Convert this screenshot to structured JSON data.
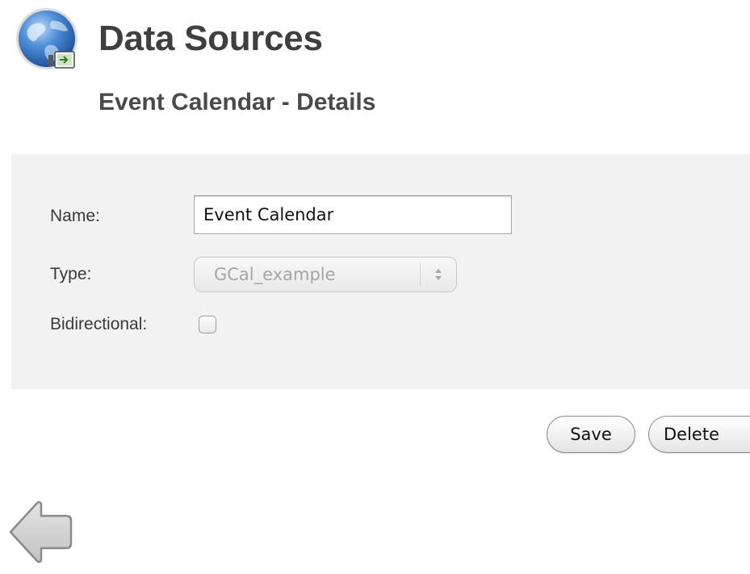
{
  "header": {
    "title": "Data Sources",
    "icon": "globe-datasource-icon"
  },
  "section": {
    "title": "Event Calendar - Details"
  },
  "form": {
    "name_label": "Name:",
    "name_value": "Event Calendar",
    "type_label": "Type:",
    "type_value": "GCal_example",
    "type_disabled": true,
    "bidirectional_label": "Bidirectional:",
    "bidirectional_checked": false
  },
  "actions": {
    "save_label": "Save",
    "delete_label": "Delete"
  },
  "navigation": {
    "back_icon": "back-arrow-icon"
  },
  "colors": {
    "panel_background": "#f2f2f2",
    "title_text": "#3f3f3f",
    "globe_blue": "#3a78c9"
  }
}
